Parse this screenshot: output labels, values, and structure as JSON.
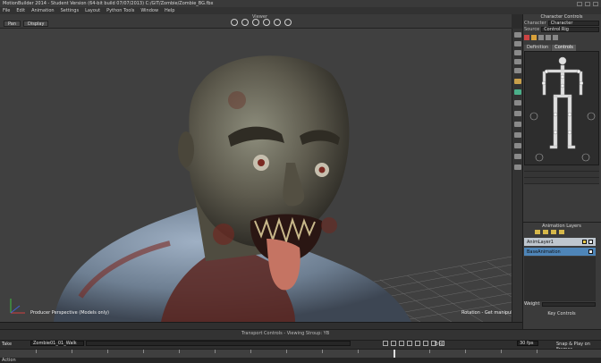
{
  "window": {
    "title": "MotionBuilder 2014 - Student Version  (64-bit build 07/07/2013)  C:/GIT/Zombie/Zombie_BG.fbx"
  },
  "menu": [
    "File",
    "Edit",
    "Animation",
    "Settings",
    "Layout",
    "Python Tools",
    "Window",
    "Help"
  ],
  "viewer": {
    "label": "Viewer",
    "buttons": [
      "Pan",
      "Display"
    ]
  },
  "viewport": {
    "left_label": "Producer Perspective (Models only)",
    "right_label": "Rotation - Get manipulator"
  },
  "character_controls": {
    "title": "Character Controls",
    "character_label": "Character",
    "character_value": "Character",
    "source_label": "Source",
    "source_value": "Control Rig",
    "tabs": [
      "Definition",
      "Controls"
    ],
    "active_tab": "Controls"
  },
  "animation_layers": {
    "title": "Animation Layers",
    "layers": [
      "AnimLayer1",
      "BaseAnimation"
    ],
    "weight_label": "Weight"
  },
  "key_controls": {
    "title": "Key Controls",
    "animation_label": "Animation",
    "type_label": "Type",
    "type_value": "TimeDelta",
    "mode_label": "Base Animation",
    "buttons": [
      "Zero",
      "Pose",
      "Body"
    ]
  },
  "transport": {
    "title": "Transport Controls - Viewing Stroup: YB",
    "take_label": "Take",
    "take_value": "Zombie01_01_Walk",
    "fps_value": "30 fps",
    "snap_label": "Snap & Play on Frames",
    "end_value": "100",
    "action_label": "Action",
    "end_label": "End"
  },
  "accent": "#4e85b8"
}
